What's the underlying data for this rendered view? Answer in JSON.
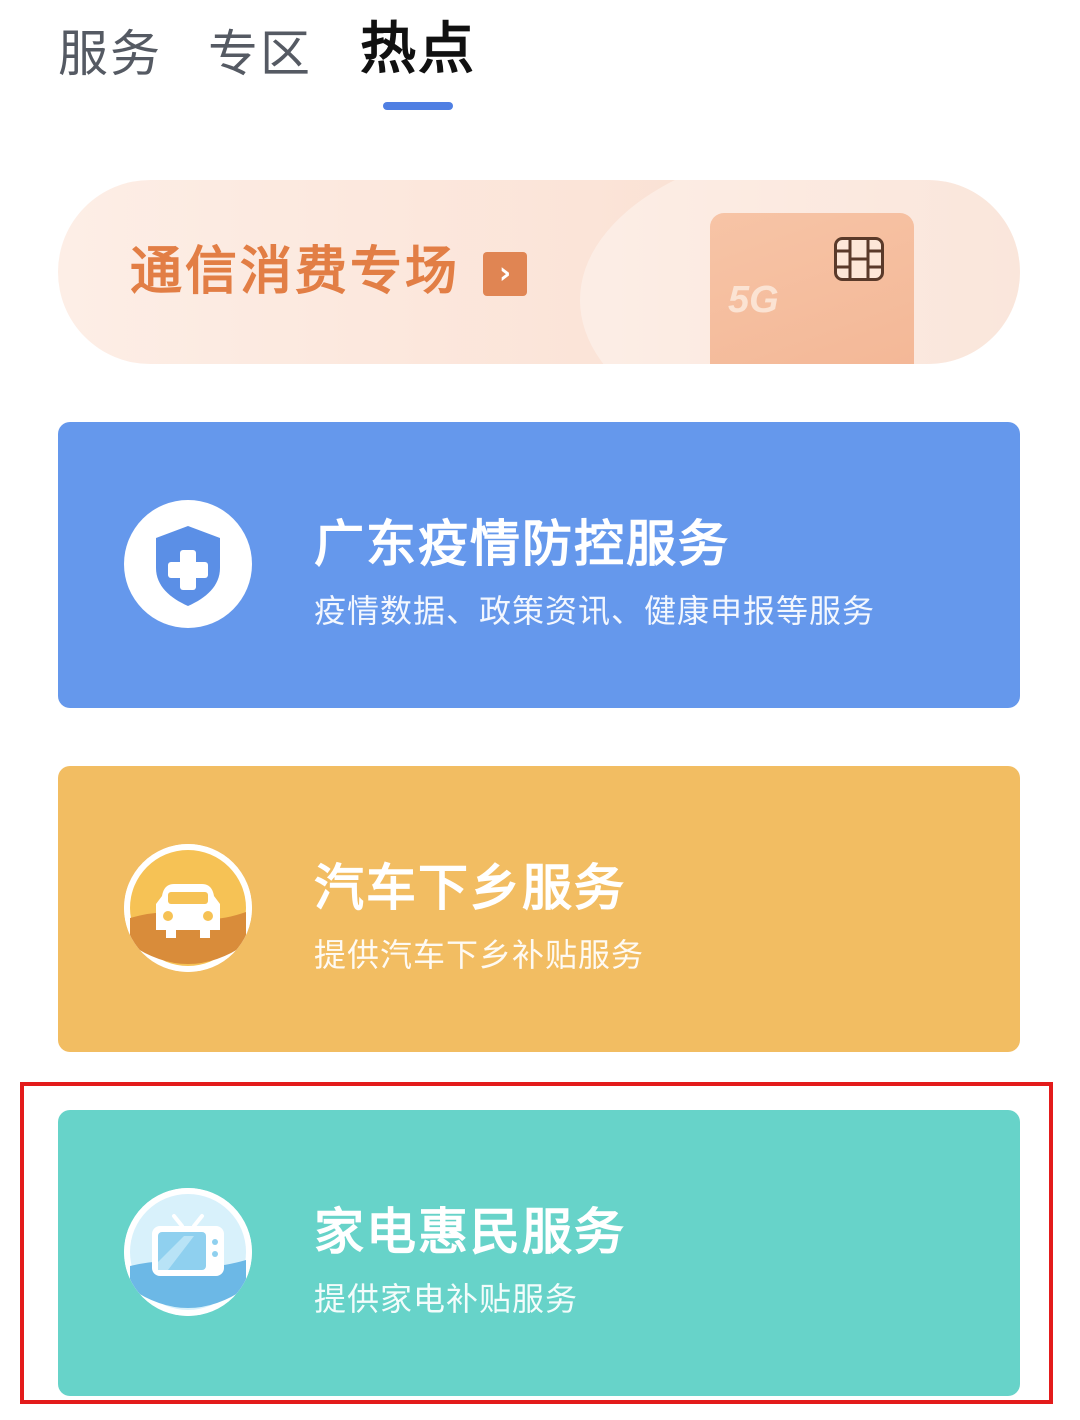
{
  "tabs": [
    {
      "label": "服务"
    },
    {
      "label": "专区"
    },
    {
      "label": "热点",
      "active": true
    }
  ],
  "promo": {
    "title": "通信消费专场",
    "arrow": "›",
    "card_label": "5G"
  },
  "cards": [
    {
      "title": "广东疫情防控服务",
      "subtitle": "疫情数据、政策资讯、健康申报等服务",
      "icon": "shield-plus-icon",
      "color": "#6598ec"
    },
    {
      "title": "汽车下乡服务",
      "subtitle": "提供汽车下乡补贴服务",
      "icon": "car-icon",
      "color": "#f2bd62"
    },
    {
      "title": "家电惠民服务",
      "subtitle": "提供家电补贴服务",
      "icon": "tv-icon",
      "color": "#67d3c9"
    }
  ],
  "highlight": {
    "color": "#e31b1b"
  }
}
